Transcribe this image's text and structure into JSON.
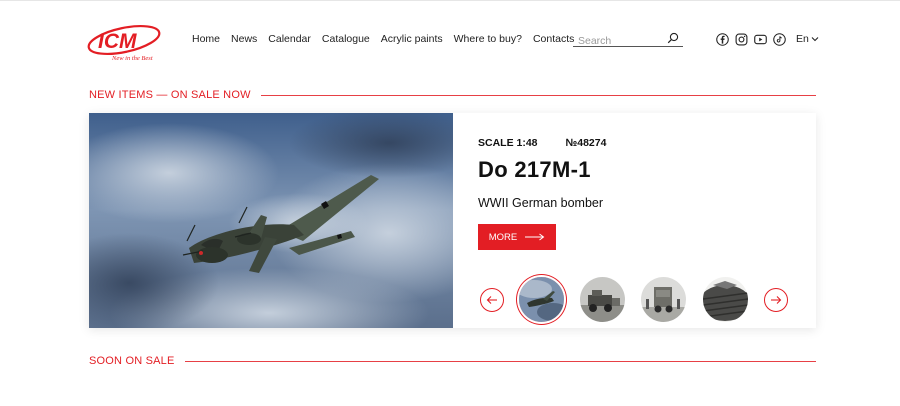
{
  "brand": {
    "logo_text": "ICM",
    "logo_tagline": "New in the Best",
    "accent_color": "#e31e24"
  },
  "nav": {
    "items": [
      {
        "label": "Home"
      },
      {
        "label": "News"
      },
      {
        "label": "Calendar"
      },
      {
        "label": "Catalogue"
      },
      {
        "label": "Acrylic paints"
      },
      {
        "label": "Where to buy?"
      },
      {
        "label": "Contacts"
      }
    ]
  },
  "search": {
    "placeholder": "Search",
    "icon": "search-icon"
  },
  "socials": {
    "icons": [
      "facebook-icon",
      "instagram-icon",
      "youtube-icon",
      "tiktok-icon"
    ]
  },
  "language": {
    "current": "En",
    "icon": "chevron-down-icon"
  },
  "sections": {
    "new_items": {
      "title": "NEW ITEMS — ON SALE NOW"
    },
    "soon": {
      "title": "SOON ON SALE"
    }
  },
  "featured": {
    "scale": "SCALE 1:48",
    "number": "№48274",
    "title": "Do 217M-1",
    "subtitle": "WWII German bomber",
    "more_label": "MORE",
    "thumbnails": [
      {
        "name": "aircraft-thumbnail",
        "active": true
      },
      {
        "name": "vehicle-thumbnail",
        "active": false
      },
      {
        "name": "truck-thumbnail",
        "active": false
      },
      {
        "name": "terrain-thumbnail",
        "active": false
      }
    ]
  }
}
